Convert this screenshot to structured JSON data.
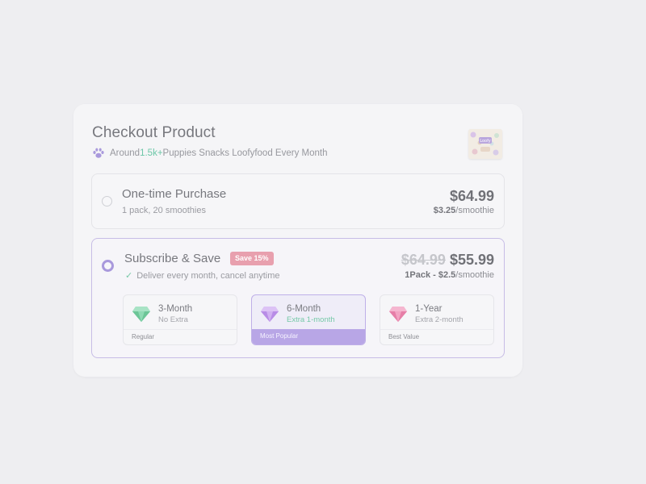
{
  "checkout": {
    "title": "Checkout Product",
    "subtitle_prefix": "Around ",
    "subtitle_highlight": "1.5k+",
    "subtitle_suffix": " Puppies Snacks Loofyfood Every Month",
    "product_image_label": "Loofy"
  },
  "one_time": {
    "title": "One-time Purchase",
    "description": "1 pack, 20 smoothies",
    "price": "$64.99",
    "unit_price": "$3.25",
    "unit_suffix": "/smoothie"
  },
  "subscribe": {
    "title": "Subscribe & Save",
    "badge": "Save 15%",
    "description": "Deliver every month, cancel anytime",
    "old_price": "$64.99",
    "price": "$55.99",
    "unit_price": "1Pack - $2.5",
    "unit_suffix": "/smoothie",
    "plans": [
      {
        "name": "3-Month",
        "sub": "No Extra",
        "footer": "Regular",
        "gem_color": "#7ed3a8"
      },
      {
        "name": "6-Month",
        "sub": "Extra 1-month",
        "footer": "Most Popular",
        "gem_color": "#c9a3ee"
      },
      {
        "name": "1-Year",
        "sub": "Extra 2-month",
        "footer": "Best Value",
        "gem_color": "#ef93b8"
      }
    ]
  },
  "colors": {
    "accent": "#a999dc",
    "highlight_green": "#6dc7a8",
    "badge": "#e8a0ae"
  }
}
